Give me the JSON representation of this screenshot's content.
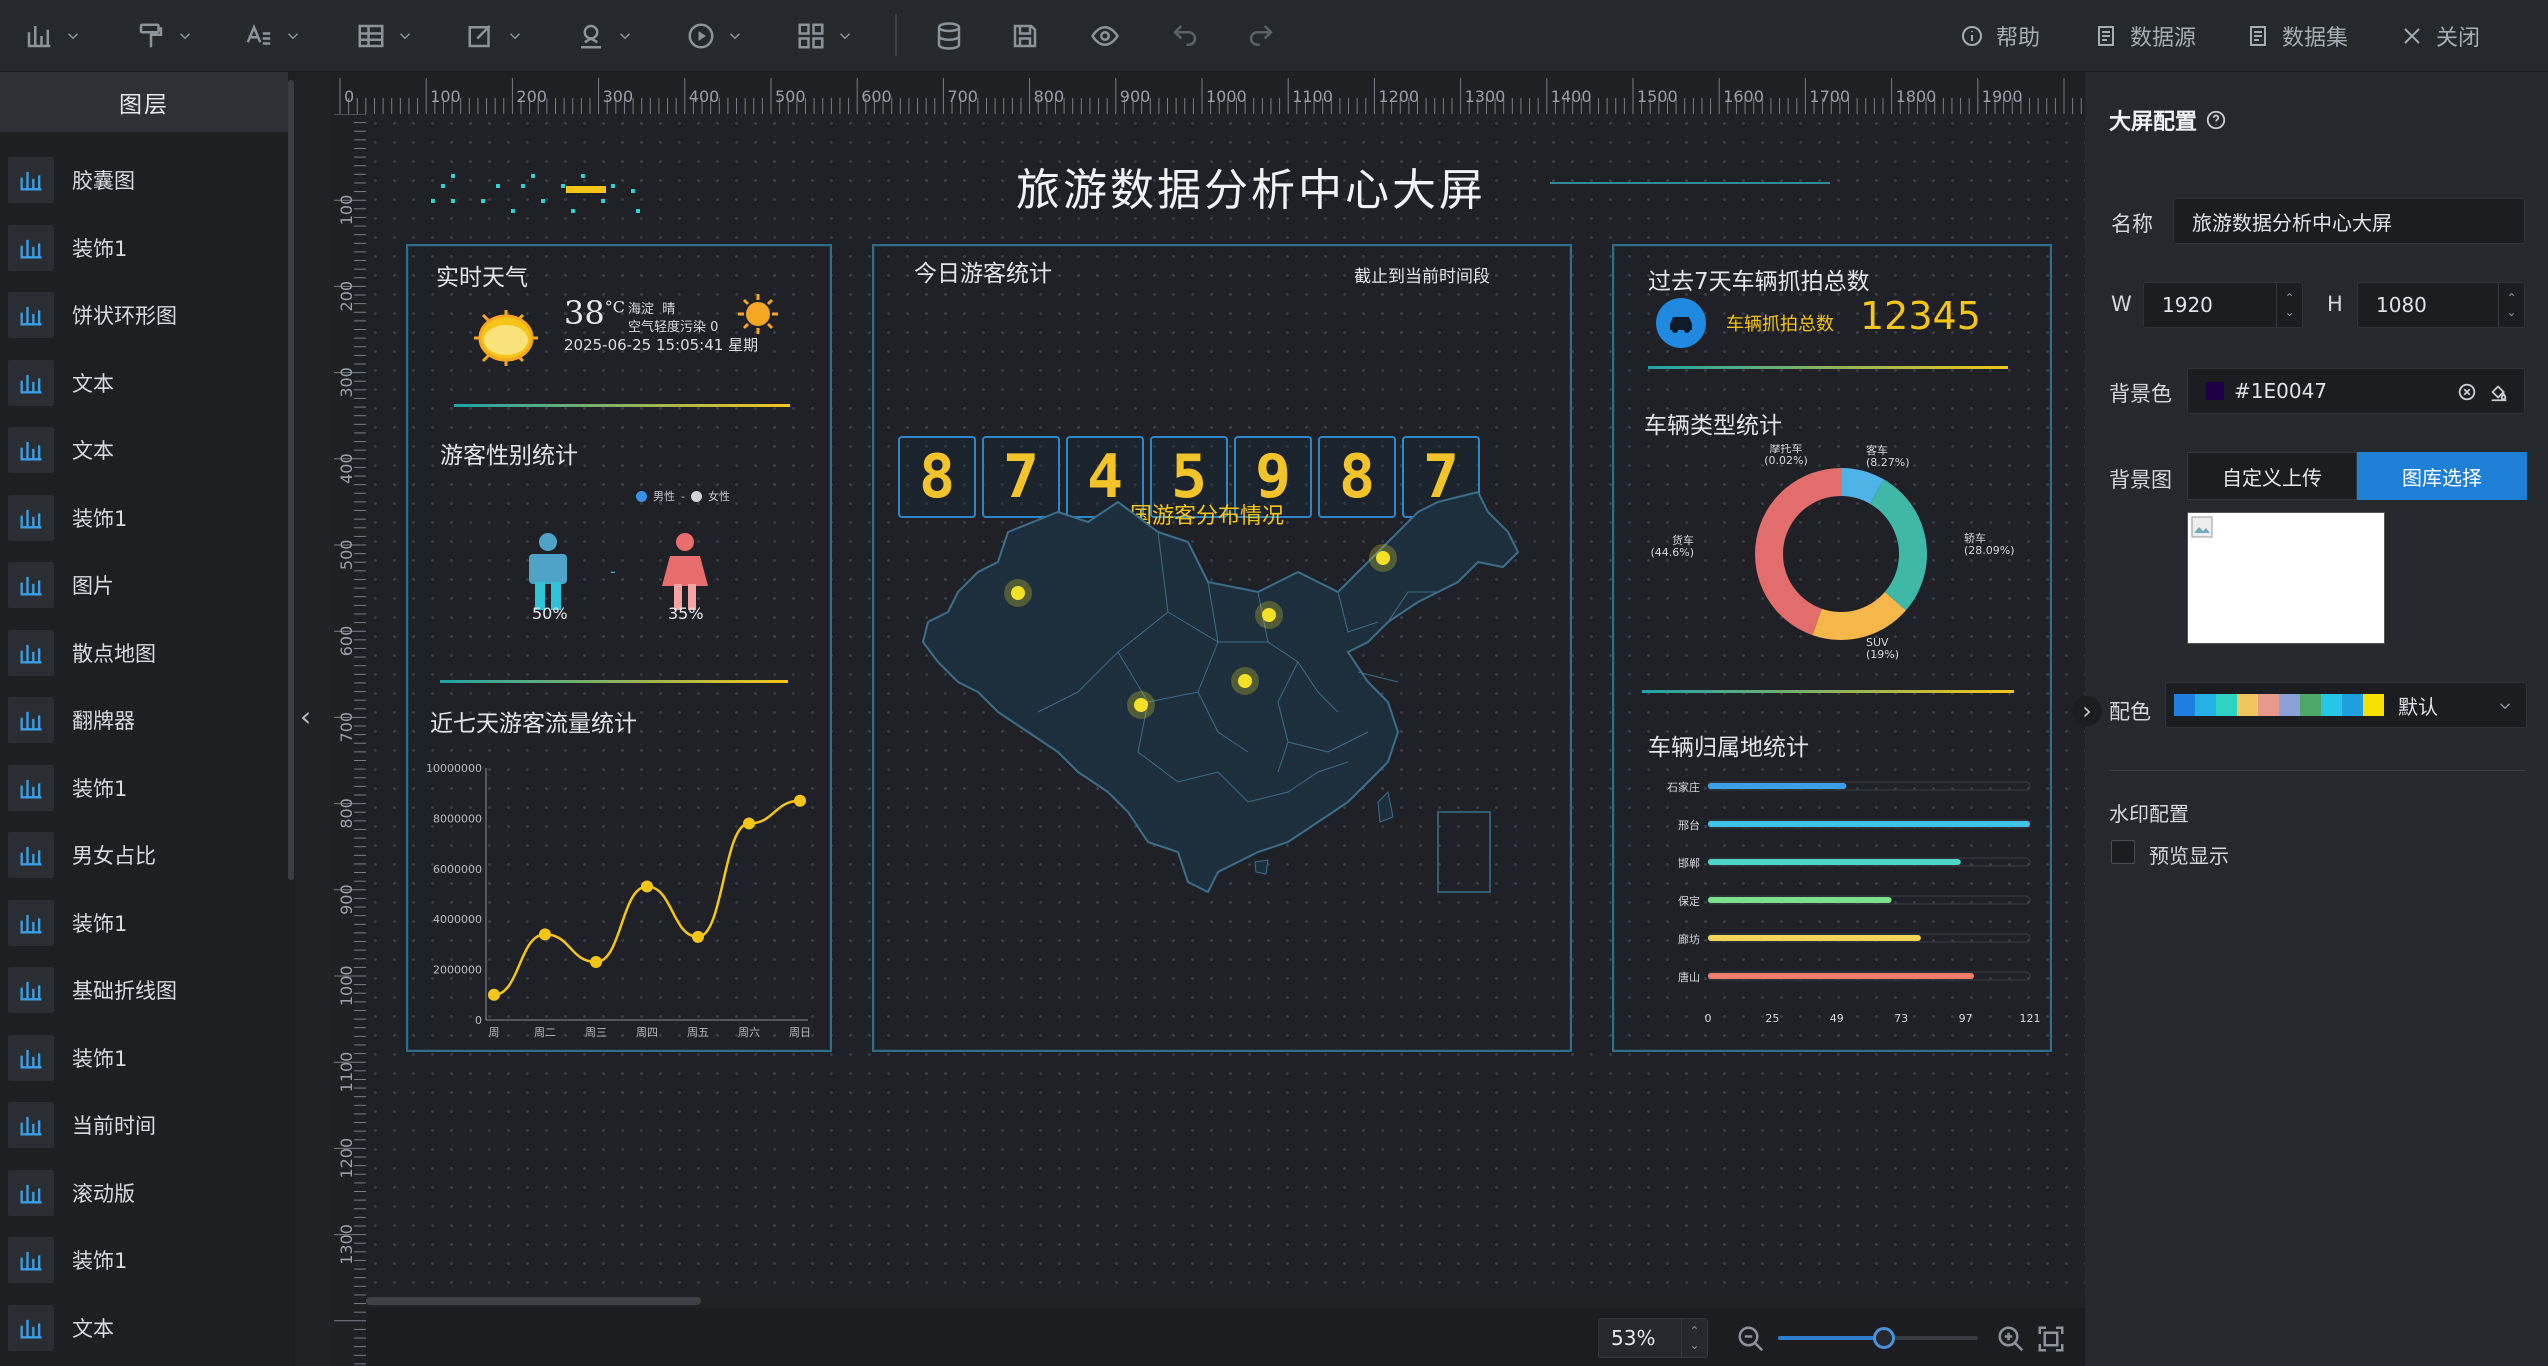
{
  "toolbar": {
    "help": "帮助",
    "datasource": "数据源",
    "dataset": "数据集",
    "close": "关闭"
  },
  "layers": {
    "header": "图层",
    "items": [
      "胶囊图",
      "装饰1",
      "饼状环形图",
      "文本",
      "文本",
      "装饰1",
      "图片",
      "散点地图",
      "翻牌器",
      "装饰1",
      "男女占比",
      "装饰1",
      "基础折线图",
      "装饰1",
      "当前时间",
      "滚动版",
      "装饰1",
      "文本"
    ]
  },
  "ruler": {
    "top": [
      "0",
      "100",
      "200",
      "300",
      "400",
      "500",
      "600",
      "700",
      "800",
      "900",
      "1000",
      "1100",
      "1200",
      "1300",
      "1400",
      "1500",
      "1600",
      "1700",
      "1800",
      "1900"
    ],
    "left": [
      "100",
      "200",
      "300",
      "400",
      "500",
      "600",
      "700",
      "800",
      "900",
      "1000",
      "1100",
      "1200",
      "1300"
    ]
  },
  "screen": {
    "title": "旅游数据分析中心大屏",
    "weather": {
      "title": "实时天气",
      "temp": "38",
      "unit": "°C",
      "location": "海淀",
      "condition": "晴",
      "air": "空气轻度污染 0",
      "datetime": "2025-06-25 15:05:41",
      "weekday": "星期"
    },
    "gender": {
      "title": "游客性别统计",
      "legend_male": "男性",
      "legend_female": "女性",
      "male_pct": "50%",
      "female_pct": "35%",
      "separator": "-"
    },
    "flow": {
      "title": "近七天游客流量统计",
      "yticks": [
        "10000000",
        "8000000",
        "6000000",
        "4000000",
        "2000000",
        "0"
      ],
      "days": [
        "周",
        "周二",
        "周三",
        "周四",
        "周五",
        "周六",
        "周日"
      ]
    },
    "visitors": {
      "title": "今日游客统计",
      "note": "截止到当前时间段",
      "digits": [
        "8",
        "7",
        "4",
        "5",
        "9",
        "8",
        "7"
      ],
      "map_title": "全国游客分布情况"
    },
    "cars": {
      "title": "过去7天车辆抓拍总数",
      "label": "车辆抓拍总数",
      "value": "12345",
      "type_title": "车辆类型统计",
      "pie_labels": [
        {
          "name": "摩托车",
          "pct": "(0.02%)"
        },
        {
          "name": "客车",
          "pct": "(8.27%)"
        },
        {
          "name": "轿车",
          "pct": "(28.09%)"
        },
        {
          "name": "SUV",
          "pct": "(19%)"
        },
        {
          "name": "货车",
          "pct": "(44.6%)"
        }
      ],
      "region_title": "车辆归属地统计",
      "region_axis": [
        "0",
        "25",
        "49",
        "73",
        "97",
        "121"
      ]
    }
  },
  "chart_data": [
    {
      "type": "line",
      "title": "近七天游客流量统计",
      "categories": [
        "周",
        "周二",
        "周三",
        "周四",
        "周五",
        "周六",
        "周日"
      ],
      "values": [
        1000000,
        3400000,
        2300000,
        5300000,
        3300000,
        7800000,
        8700000
      ],
      "ylim": [
        0,
        10000000
      ],
      "color": "#f5c518"
    },
    {
      "type": "pie",
      "title": "车辆类型统计",
      "labels": [
        "摩托车",
        "客车",
        "轿车",
        "SUV",
        "货车"
      ],
      "values": [
        0.02,
        8.27,
        28.09,
        19,
        44.6
      ],
      "colors": [
        "#8ecbf0",
        "#4fb3e8",
        "#3fb8a8",
        "#f5b74a",
        "#e26d6d"
      ]
    },
    {
      "type": "bar",
      "orientation": "horizontal",
      "title": "车辆归属地统计",
      "categories": [
        "石家庄",
        "邢台",
        "邯郸",
        "保定",
        "廊坊",
        "唐山"
      ],
      "values": [
        52,
        121,
        95,
        69,
        80,
        100
      ],
      "xlim": [
        0,
        121
      ],
      "colors": [
        "#3b9fe6",
        "#3fc3e6",
        "#4fd6c9",
        "#7de08a",
        "#f5d45a",
        "#f07d6a"
      ]
    }
  ],
  "right": {
    "title": "大屏配置",
    "name_label": "名称",
    "name_value": "旅游数据分析中心大屏",
    "w_label": "W",
    "w_value": "1920",
    "h_label": "H",
    "h_value": "1080",
    "bg_label": "背景色",
    "bg_value": "#1E0047",
    "bgimg_label": "背景图",
    "upload_btn": "自定义上传",
    "gallery_btn": "图库选择",
    "palette_label": "配色",
    "palette_value": "默认",
    "palette_colors": [
      "#1e7fe0",
      "#25b0e6",
      "#2dd4c4",
      "#f0c75e",
      "#e89a8a",
      "#8aa0d8",
      "#4fa86a",
      "#25c6e6",
      "#1e9fe0",
      "#f5e000"
    ],
    "watermark_title": "水印配置",
    "preview_label": "预览显示"
  },
  "zoom": {
    "value": "53%",
    "level": 0.53
  }
}
